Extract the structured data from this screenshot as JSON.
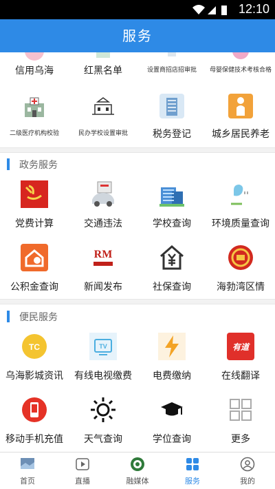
{
  "status_bar": {
    "time": "12:10"
  },
  "header": {
    "title": "服务"
  },
  "top_services": [
    {
      "label": "信用乌海",
      "icon": "credit-icon"
    },
    {
      "label": "红黑名单",
      "icon": "list-icon"
    },
    {
      "label": "设置商招店招审批",
      "icon": "sign-approval-icon"
    },
    {
      "label": "母婴保健技术考核合格",
      "icon": "maternal-icon"
    },
    {
      "label": "二级医疗机构校验",
      "icon": "hospital-icon"
    },
    {
      "label": "民办学校设置审批",
      "icon": "school-approval-icon"
    },
    {
      "label": "税务登记",
      "icon": "tax-icon"
    },
    {
      "label": "城乡居民养老",
      "icon": "pension-icon"
    }
  ],
  "sections": {
    "government": {
      "title": "政务服务",
      "items": [
        {
          "label": "党费计算",
          "icon": "party-fee-icon"
        },
        {
          "label": "交通违法",
          "icon": "traffic-icon"
        },
        {
          "label": "学校查询",
          "icon": "school-icon"
        },
        {
          "label": "环境质量查询",
          "icon": "environment-icon"
        },
        {
          "label": "公积金查询",
          "icon": "housing-fund-icon"
        },
        {
          "label": "新闻发布",
          "icon": "news-icon"
        },
        {
          "label": "社保查询",
          "icon": "social-security-icon"
        },
        {
          "label": "海勃湾区情",
          "icon": "emblem-icon"
        }
      ]
    },
    "convenience": {
      "title": "便民服务",
      "items": [
        {
          "label": "乌海影城资讯",
          "icon": "cinema-icon"
        },
        {
          "label": "有线电视缴费",
          "icon": "tv-icon"
        },
        {
          "label": "电费缴纳",
          "icon": "electricity-icon"
        },
        {
          "label": "在线翻译",
          "icon": "translate-icon",
          "icon_text": "有道"
        },
        {
          "label": "移动手机充值",
          "icon": "phone-recharge-icon"
        },
        {
          "label": "天气查询",
          "icon": "weather-icon"
        },
        {
          "label": "学位查询",
          "icon": "degree-icon"
        },
        {
          "label": "更多",
          "icon": "more-icon"
        }
      ]
    }
  },
  "tabbar": [
    {
      "label": "首页",
      "icon": "home-icon",
      "active": false
    },
    {
      "label": "直播",
      "icon": "live-icon",
      "active": false
    },
    {
      "label": "融媒体",
      "icon": "media-icon",
      "active": false
    },
    {
      "label": "服务",
      "icon": "service-icon",
      "active": true
    },
    {
      "label": "我的",
      "icon": "profile-icon",
      "active": false
    }
  ],
  "colors": {
    "brand": "#2e8ae6",
    "divider": "#f2f2f2"
  }
}
